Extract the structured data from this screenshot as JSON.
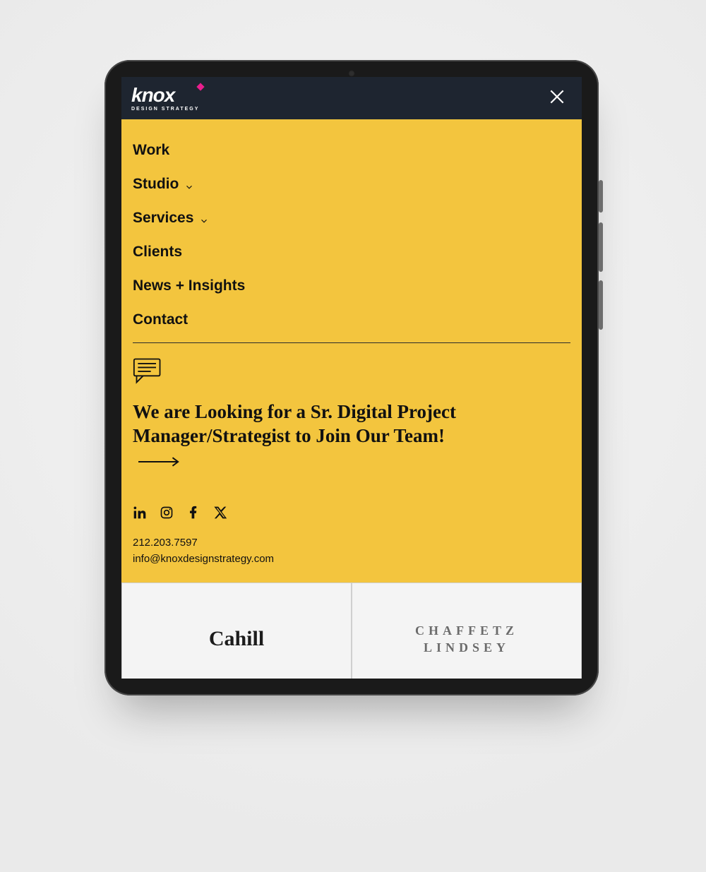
{
  "brand": {
    "name": "knox",
    "tagline": "DESIGN STRATEGY"
  },
  "nav": {
    "items": [
      {
        "label": "Work",
        "has_submenu": false
      },
      {
        "label": "Studio",
        "has_submenu": true
      },
      {
        "label": "Services",
        "has_submenu": true
      },
      {
        "label": "Clients",
        "has_submenu": false
      },
      {
        "label": "News + Insights",
        "has_submenu": false
      },
      {
        "label": "Contact",
        "has_submenu": false
      }
    ]
  },
  "cta": {
    "text": "We are Looking for a Sr. Digital Project Manager/Strategist to Join Our Team!"
  },
  "social": {
    "items": [
      "linkedin",
      "instagram",
      "facebook",
      "x-twitter"
    ]
  },
  "contact": {
    "phone": "212.203.7597",
    "email": "info@knoxdesignstrategy.com"
  },
  "clients": {
    "row": [
      {
        "name": "Cahill"
      },
      {
        "name_line1": "Chaffetz",
        "name_line2": "Lindsey"
      }
    ]
  },
  "colors": {
    "accent": "#f3c53e",
    "header": "#1e2530",
    "brand_dot": "#e91e8c"
  }
}
